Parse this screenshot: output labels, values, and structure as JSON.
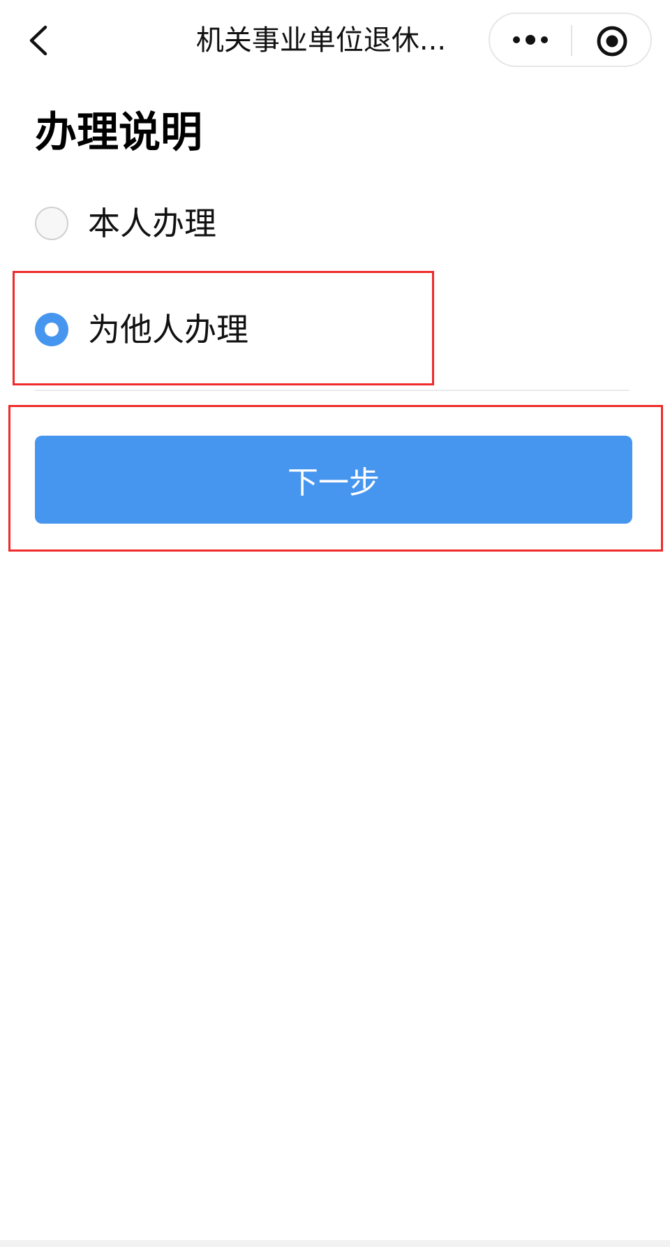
{
  "nav": {
    "title": "机关事业单位退休...",
    "back_icon": "chevron-left-icon",
    "more_icon": "more-dots-icon",
    "record_icon": "target-circle-icon"
  },
  "page": {
    "title": "办理说明"
  },
  "options": [
    {
      "label": "本人办理",
      "checked": false
    },
    {
      "label": "为他人办理",
      "checked": true
    }
  ],
  "actions": {
    "next_label": "下一步"
  },
  "colors": {
    "accent": "#4695ef",
    "highlight": "#ef2a2a"
  }
}
